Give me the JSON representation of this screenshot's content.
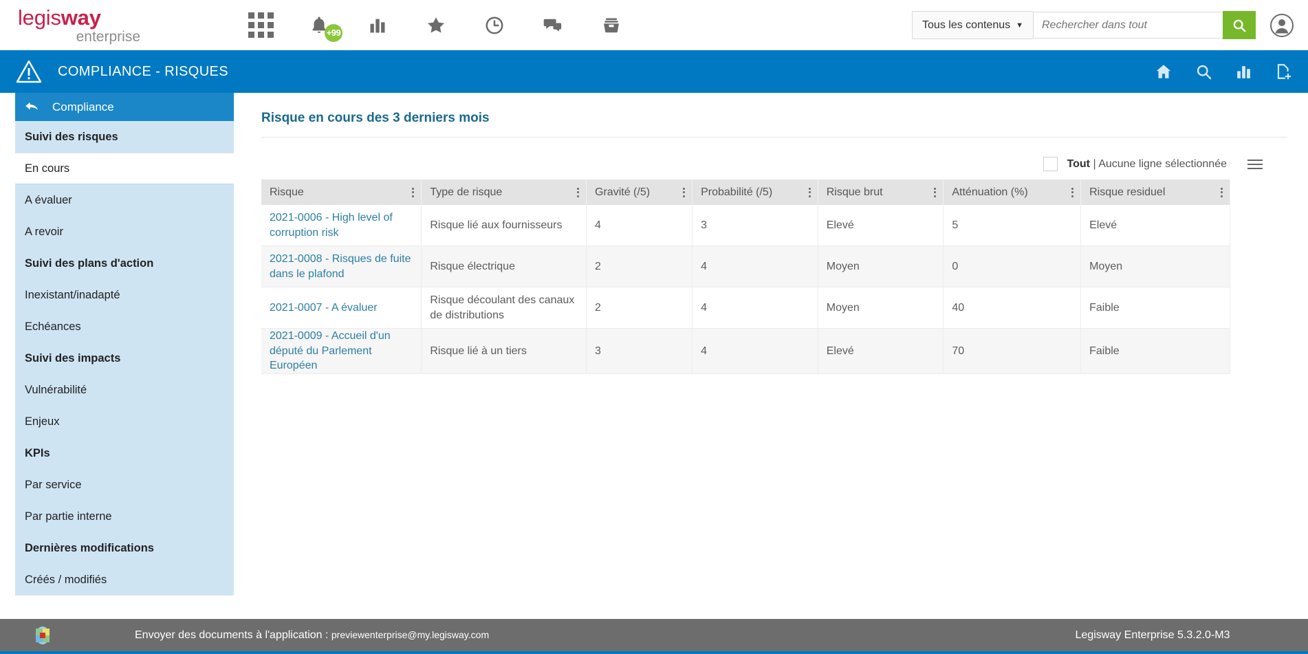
{
  "topbar": {
    "logo_primary": "legis",
    "logo_primary_bold": "way",
    "logo_secondary": "enterprise",
    "icons": [
      {
        "name": "apps-grid-icon",
        "label": "Applications"
      },
      {
        "name": "bell-icon",
        "label": "Notifications",
        "badge": "+99"
      },
      {
        "name": "bar-chart-icon",
        "label": "Rapports"
      },
      {
        "name": "star-icon",
        "label": "Favoris"
      },
      {
        "name": "clock-icon",
        "label": "Historique"
      },
      {
        "name": "chat-icon",
        "label": "Discussions"
      },
      {
        "name": "archive-box-icon",
        "label": "Archives"
      }
    ],
    "search_scope": "Tous les contenus",
    "search_placeholder": "Rechercher dans tout",
    "search_value": "",
    "search_button": "search-icon",
    "avatar": "user-avatar-icon"
  },
  "pagebar": {
    "title": "COMPLIANCE - RISQUES",
    "warning_icon": "warning-triangle-icon",
    "icons": [
      {
        "name": "home-icon",
        "label": "Accueil"
      },
      {
        "name": "search-icon",
        "label": "Rechercher"
      },
      {
        "name": "bar-chart-icon",
        "label": "Statistiques"
      },
      {
        "name": "new-document-icon",
        "label": "Nouveau"
      }
    ]
  },
  "sidebar": {
    "header": "Compliance",
    "back_icon": "back-arrow-icon",
    "items": [
      {
        "label": "Suivi des risques",
        "type": "group"
      },
      {
        "label": "En cours",
        "type": "active"
      },
      {
        "label": "A évaluer",
        "type": "child"
      },
      {
        "label": "A revoir",
        "type": "child"
      },
      {
        "label": "Suivi des plans d'action",
        "type": "group"
      },
      {
        "label": "Inexistant/inadapté",
        "type": "child"
      },
      {
        "label": "Echéances",
        "type": "child"
      },
      {
        "label": "Suivi des impacts",
        "type": "group"
      },
      {
        "label": "Vulnérabilité",
        "type": "child"
      },
      {
        "label": "Enjeux",
        "type": "child"
      },
      {
        "label": "KPIs",
        "type": "group"
      },
      {
        "label": "Par service",
        "type": "child"
      },
      {
        "label": "Par partie interne",
        "type": "child"
      },
      {
        "label": "Dernières modifications",
        "type": "group"
      },
      {
        "label": "Créés / modifiés",
        "type": "child"
      }
    ]
  },
  "main": {
    "title": "Risque en cours des 3 derniers mois",
    "selection": {
      "checkbox_checked": false,
      "all_label": "Tout",
      "separator": "|",
      "status": "Aucune ligne sélectionnée",
      "menu_icon": "hamburger-menu-icon"
    },
    "table": {
      "columns": [
        "Risque",
        "Type de risque",
        "Gravité (/5)",
        "Probabilité (/5)",
        "Risque brut",
        "Atténuation (%)",
        "Risque residuel"
      ],
      "rows": [
        {
          "risque": "2021-0006 - High level of corruption risk",
          "type": "Risque lié aux fournisseurs",
          "gravite": "4",
          "probabilite": "3",
          "risque_brut": "Elevé",
          "attenuation": "5",
          "risque_residuel": "Elevé"
        },
        {
          "risque": "2021-0008 - Risques de fuite dans le plafond",
          "type": "Risque électrique",
          "gravite": "2",
          "probabilite": "4",
          "risque_brut": "Moyen",
          "attenuation": "0",
          "risque_residuel": "Moyen"
        },
        {
          "risque": "2021-0007 - A évaluer",
          "type": "Risque découlant des canaux de distributions",
          "gravite": "2",
          "probabilite": "4",
          "risque_brut": "Moyen",
          "attenuation": "40",
          "risque_residuel": "Faible"
        },
        {
          "risque": "2021-0009 - Accueil d'un député du Parlement Européen",
          "type": "Risque lié à un tiers",
          "gravite": "3",
          "probabilite": "4",
          "risque_brut": "Elevé",
          "attenuation": "70",
          "risque_residuel": "Faible"
        }
      ]
    }
  },
  "footer": {
    "logo_icon": "app-logo-icon",
    "text_label": "Envoyer des documents à l'application :",
    "email": "previewenterprise@my.legisway.com",
    "product": "Legisway Enterprise  5.3.2.0-M3"
  },
  "colors": {
    "brand_red": "#c8204b",
    "brand_green": "#76b82a",
    "accent_blue": "#0079c2",
    "sidebar_blue": "#cfe4f3",
    "title_teal": "#1a6a8e",
    "link_teal": "#2c7fa5",
    "footer_gray": "#6d6d6d",
    "badge_green": "#8cc63e"
  }
}
